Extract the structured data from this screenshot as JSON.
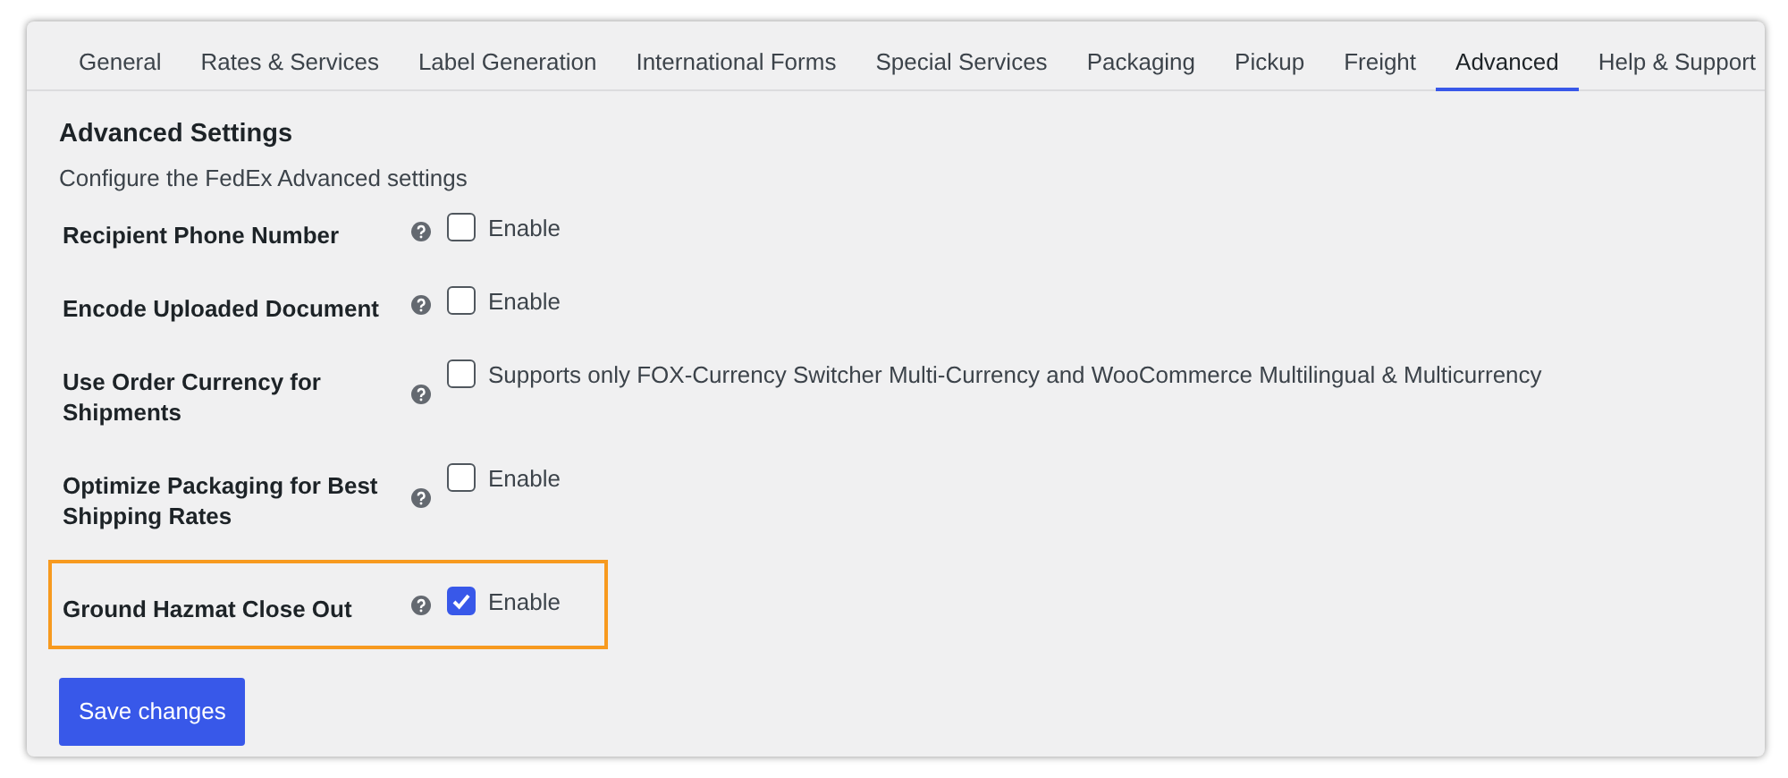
{
  "tabs": [
    {
      "label": "General",
      "selected": false
    },
    {
      "label": "Rates & Services",
      "selected": false
    },
    {
      "label": "Label Generation",
      "selected": false
    },
    {
      "label": "International Forms",
      "selected": false
    },
    {
      "label": "Special Services",
      "selected": false
    },
    {
      "label": "Packaging",
      "selected": false
    },
    {
      "label": "Pickup",
      "selected": false
    },
    {
      "label": "Freight",
      "selected": false
    },
    {
      "label": "Advanced",
      "selected": true
    },
    {
      "label": "Help & Support",
      "selected": false
    }
  ],
  "heading": "Advanced Settings",
  "description": "Configure the FedEx Advanced settings",
  "settings": [
    {
      "label": "Recipient Phone Number",
      "option": "Enable",
      "checked": false,
      "highlighted": false
    },
    {
      "label": "Encode Uploaded Document",
      "option": "Enable",
      "checked": false,
      "highlighted": false
    },
    {
      "label": "Use Order Currency for Shipments",
      "option": "Supports only FOX-Currency Switcher Multi-Currency and WooCommerce Multilingual & Multicurrency",
      "checked": false,
      "highlighted": false
    },
    {
      "label": "Optimize Packaging for Best Shipping Rates",
      "option": "Enable",
      "checked": false,
      "highlighted": false
    },
    {
      "label": "Ground Hazmat Close Out",
      "option": "Enable",
      "checked": true,
      "highlighted": true
    }
  ],
  "save_button": "Save changes"
}
